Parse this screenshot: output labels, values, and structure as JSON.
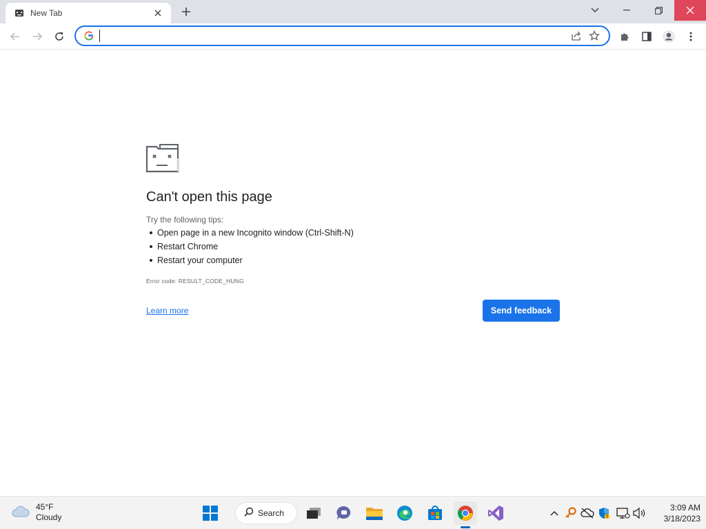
{
  "browser": {
    "tab": {
      "title": "New Tab"
    },
    "omnibox": {
      "value": "",
      "placeholder": ""
    }
  },
  "error_page": {
    "title": "Can't open this page",
    "tips_label": "Try the following tips:",
    "tips": [
      "Open page in a new Incognito window (Ctrl-Shift-N)",
      "Restart Chrome",
      "Restart your computer"
    ],
    "error_code": "Error code: RESULT_CODE_HUNG",
    "learn_more": "Learn more",
    "send_feedback": "Send feedback"
  },
  "taskbar": {
    "weather": {
      "temp": "45°F",
      "condition": "Cloudy"
    },
    "search_label": "Search",
    "clock": {
      "time": "3:09 AM",
      "date": "3/18/2023"
    }
  },
  "colors": {
    "accent": "#1a73e8",
    "close_hover": "#e0465a",
    "titlebar": "#dee1e6"
  }
}
